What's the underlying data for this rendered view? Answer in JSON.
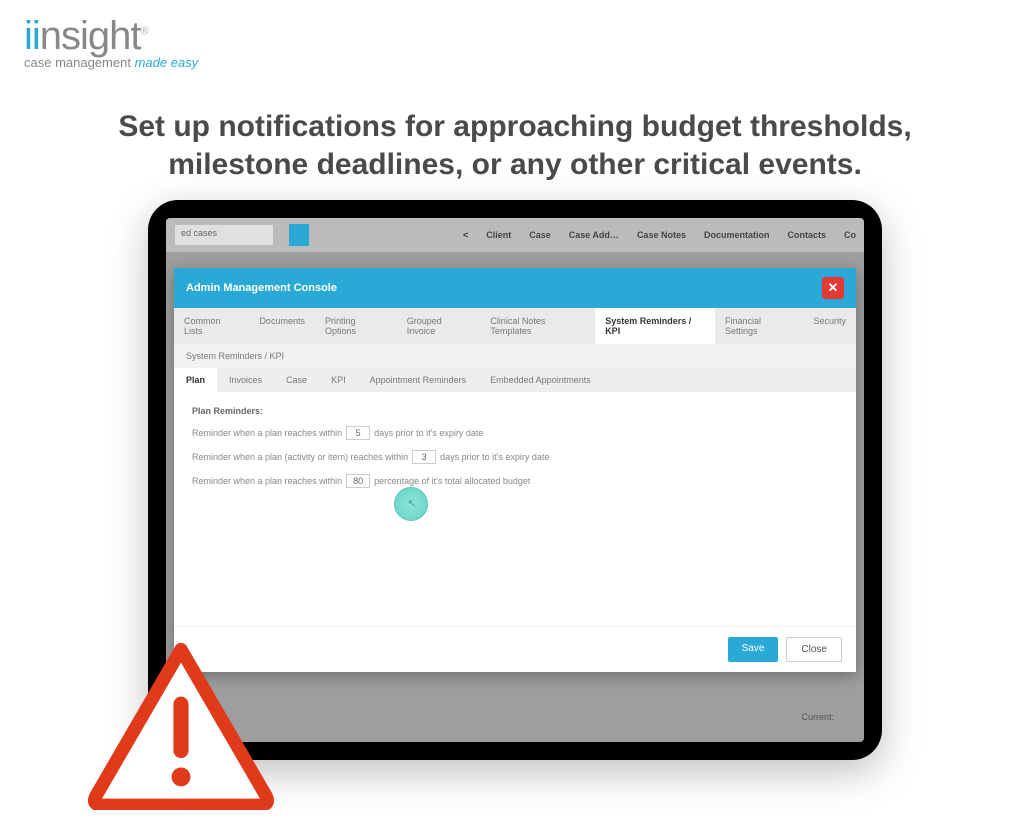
{
  "logo": {
    "brand_ii": "ii",
    "brand_rest": "nsight",
    "reg": "®",
    "tagline_a": "case management ",
    "tagline_b": "made easy"
  },
  "headline": "Set up notifications for approaching budget thresholds, milestone deadlines, or any other critical events.",
  "bg": {
    "dropdown_text": "ed cases",
    "chev": "<",
    "nav": [
      "Client",
      "Case",
      "Case Add…",
      "Case Notes",
      "Documentation",
      "Contacts",
      "Co"
    ],
    "current_label": "Current:"
  },
  "modal": {
    "title": "Admin Management Console",
    "top_tabs": [
      "Common Lists",
      "Documents",
      "Printing Options",
      "Grouped Invoice",
      "Clinical Notes Templates",
      "System Reminders / KPI",
      "Financial Settings",
      "Security"
    ],
    "active_top_tab": 5,
    "crumb": "System Reminders / KPI",
    "sub_tabs": [
      "Plan",
      "Invoices",
      "Case",
      "KPI",
      "Appointment Reminders",
      "Embedded Appointments"
    ],
    "active_sub_tab": 0,
    "section_title": "Plan Reminders:",
    "rule1_a": "Reminder when a plan reaches within",
    "rule1_val": "5",
    "rule1_b": "days prior to it's expiry date",
    "rule2_a": "Reminder when a plan (activity or item) reaches within",
    "rule2_val": "3",
    "rule2_b": "days prior to it's expiry date",
    "rule3_a": "Reminder when a plan reaches within",
    "rule3_val": "80",
    "rule3_b": "percentage of it's total allocated budget",
    "save": "Save",
    "close": "Close"
  }
}
